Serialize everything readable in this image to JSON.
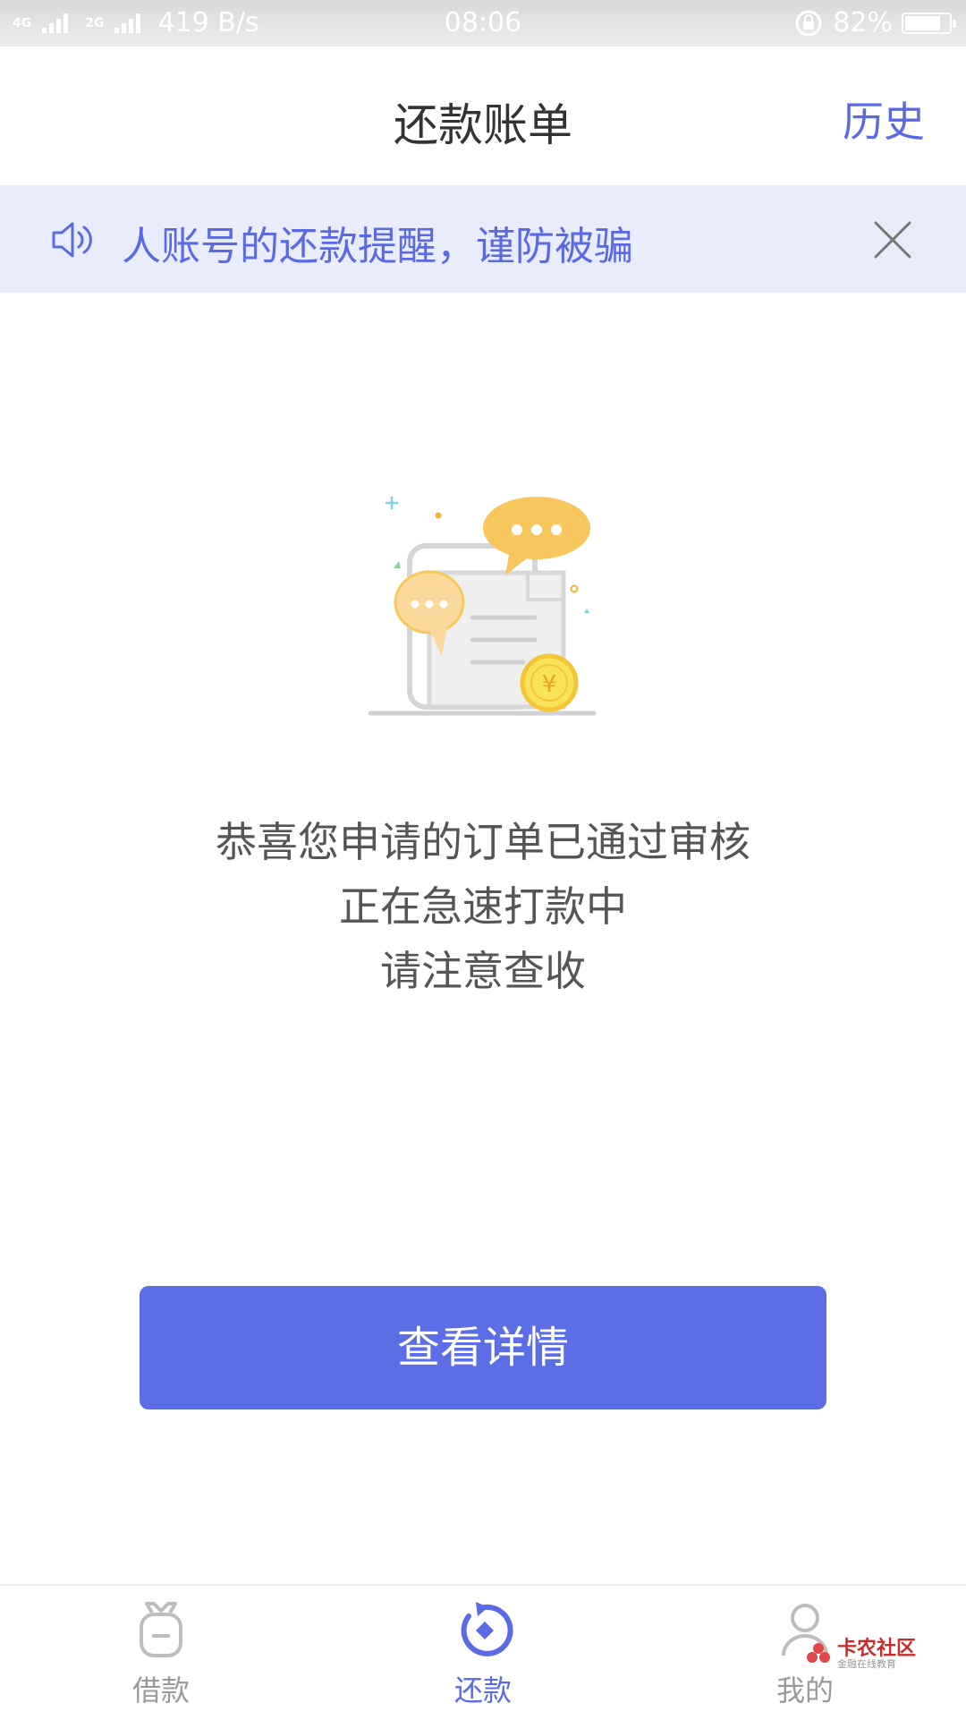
{
  "status_bar": {
    "network_1": "4G",
    "network_2": "4G",
    "network_3": "2G",
    "speed": "419 B/s",
    "time": "08:06",
    "battery_text": "82%",
    "battery_level": 0.82
  },
  "header": {
    "title": "还款账单",
    "history_label": "历史"
  },
  "notice": {
    "text": "不要相信私人账号的还款提醒，谨防被骗",
    "speaker_icon": "speaker-icon",
    "close_icon": "close-icon",
    "accent_color": "#5a6ae6",
    "background_color": "#e9edfb"
  },
  "main": {
    "message_line1": "恭喜您申请的订单已通过审核",
    "message_line2": "正在急速打款中",
    "message_line3": "请注意查收",
    "detail_button_label": "查看详情",
    "button_color": "#5b6ee6"
  },
  "tab_bar": {
    "items": [
      {
        "label": "借款",
        "icon": "loan-bag-icon",
        "active": false
      },
      {
        "label": "还款",
        "icon": "repay-icon",
        "active": true
      },
      {
        "label": "我的",
        "icon": "user-icon",
        "active": false
      }
    ],
    "active_color": "#5a6ae6",
    "inactive_color": "#9a9a9a"
  },
  "watermark": {
    "title": "卡农社区",
    "subtitle": "金融在线教育"
  }
}
